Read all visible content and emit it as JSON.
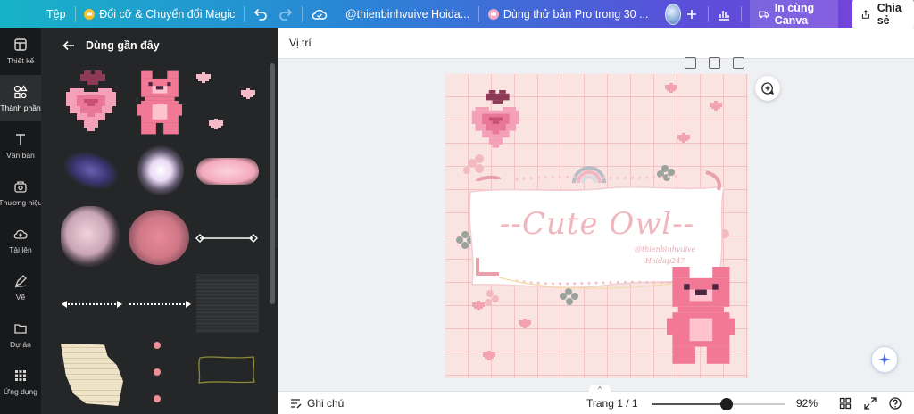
{
  "topbar": {
    "file_menu": "Tệp",
    "resize_magic": "Đổi cỡ & Chuyển đổi Magic",
    "doc_title": "@thienbinhvuive Hoida...",
    "trial": "Dùng thử bản Pro trong 30 ...",
    "print": "In cùng Canva",
    "share": "Chia sẻ"
  },
  "rail": {
    "items": [
      {
        "label": "Thiết kế",
        "icon": "layout-icon"
      },
      {
        "label": "Thành phần",
        "icon": "shapes-icon"
      },
      {
        "label": "Văn bản",
        "icon": "text-icon"
      },
      {
        "label": "Thương hiệu",
        "icon": "brand-icon"
      },
      {
        "label": "Tải lên",
        "icon": "upload-cloud-icon"
      },
      {
        "label": "Vẽ",
        "icon": "pen-icon"
      },
      {
        "label": "Dự án",
        "icon": "folder-icon"
      },
      {
        "label": "Ứng dụng",
        "icon": "apps-grid-icon"
      }
    ]
  },
  "panel": {
    "title": "Dùng gần đây"
  },
  "canvas": {
    "position_label": "Vị trí",
    "design_title": "--Cute Owl--",
    "handle_line1": "@thienbinhvuive",
    "handle_line2": "Hoidap247"
  },
  "bottombar": {
    "notes": "Ghi chú",
    "page_indicator": "Trang 1 / 1",
    "zoom_label": "92%",
    "zoom_fraction": 0.56
  },
  "colors": {
    "accent_start": "#17b3c8",
    "accent_end": "#7b3fdc",
    "rail_bg": "#18191b",
    "panel_bg": "#252627",
    "pink": "#f08aa4"
  }
}
